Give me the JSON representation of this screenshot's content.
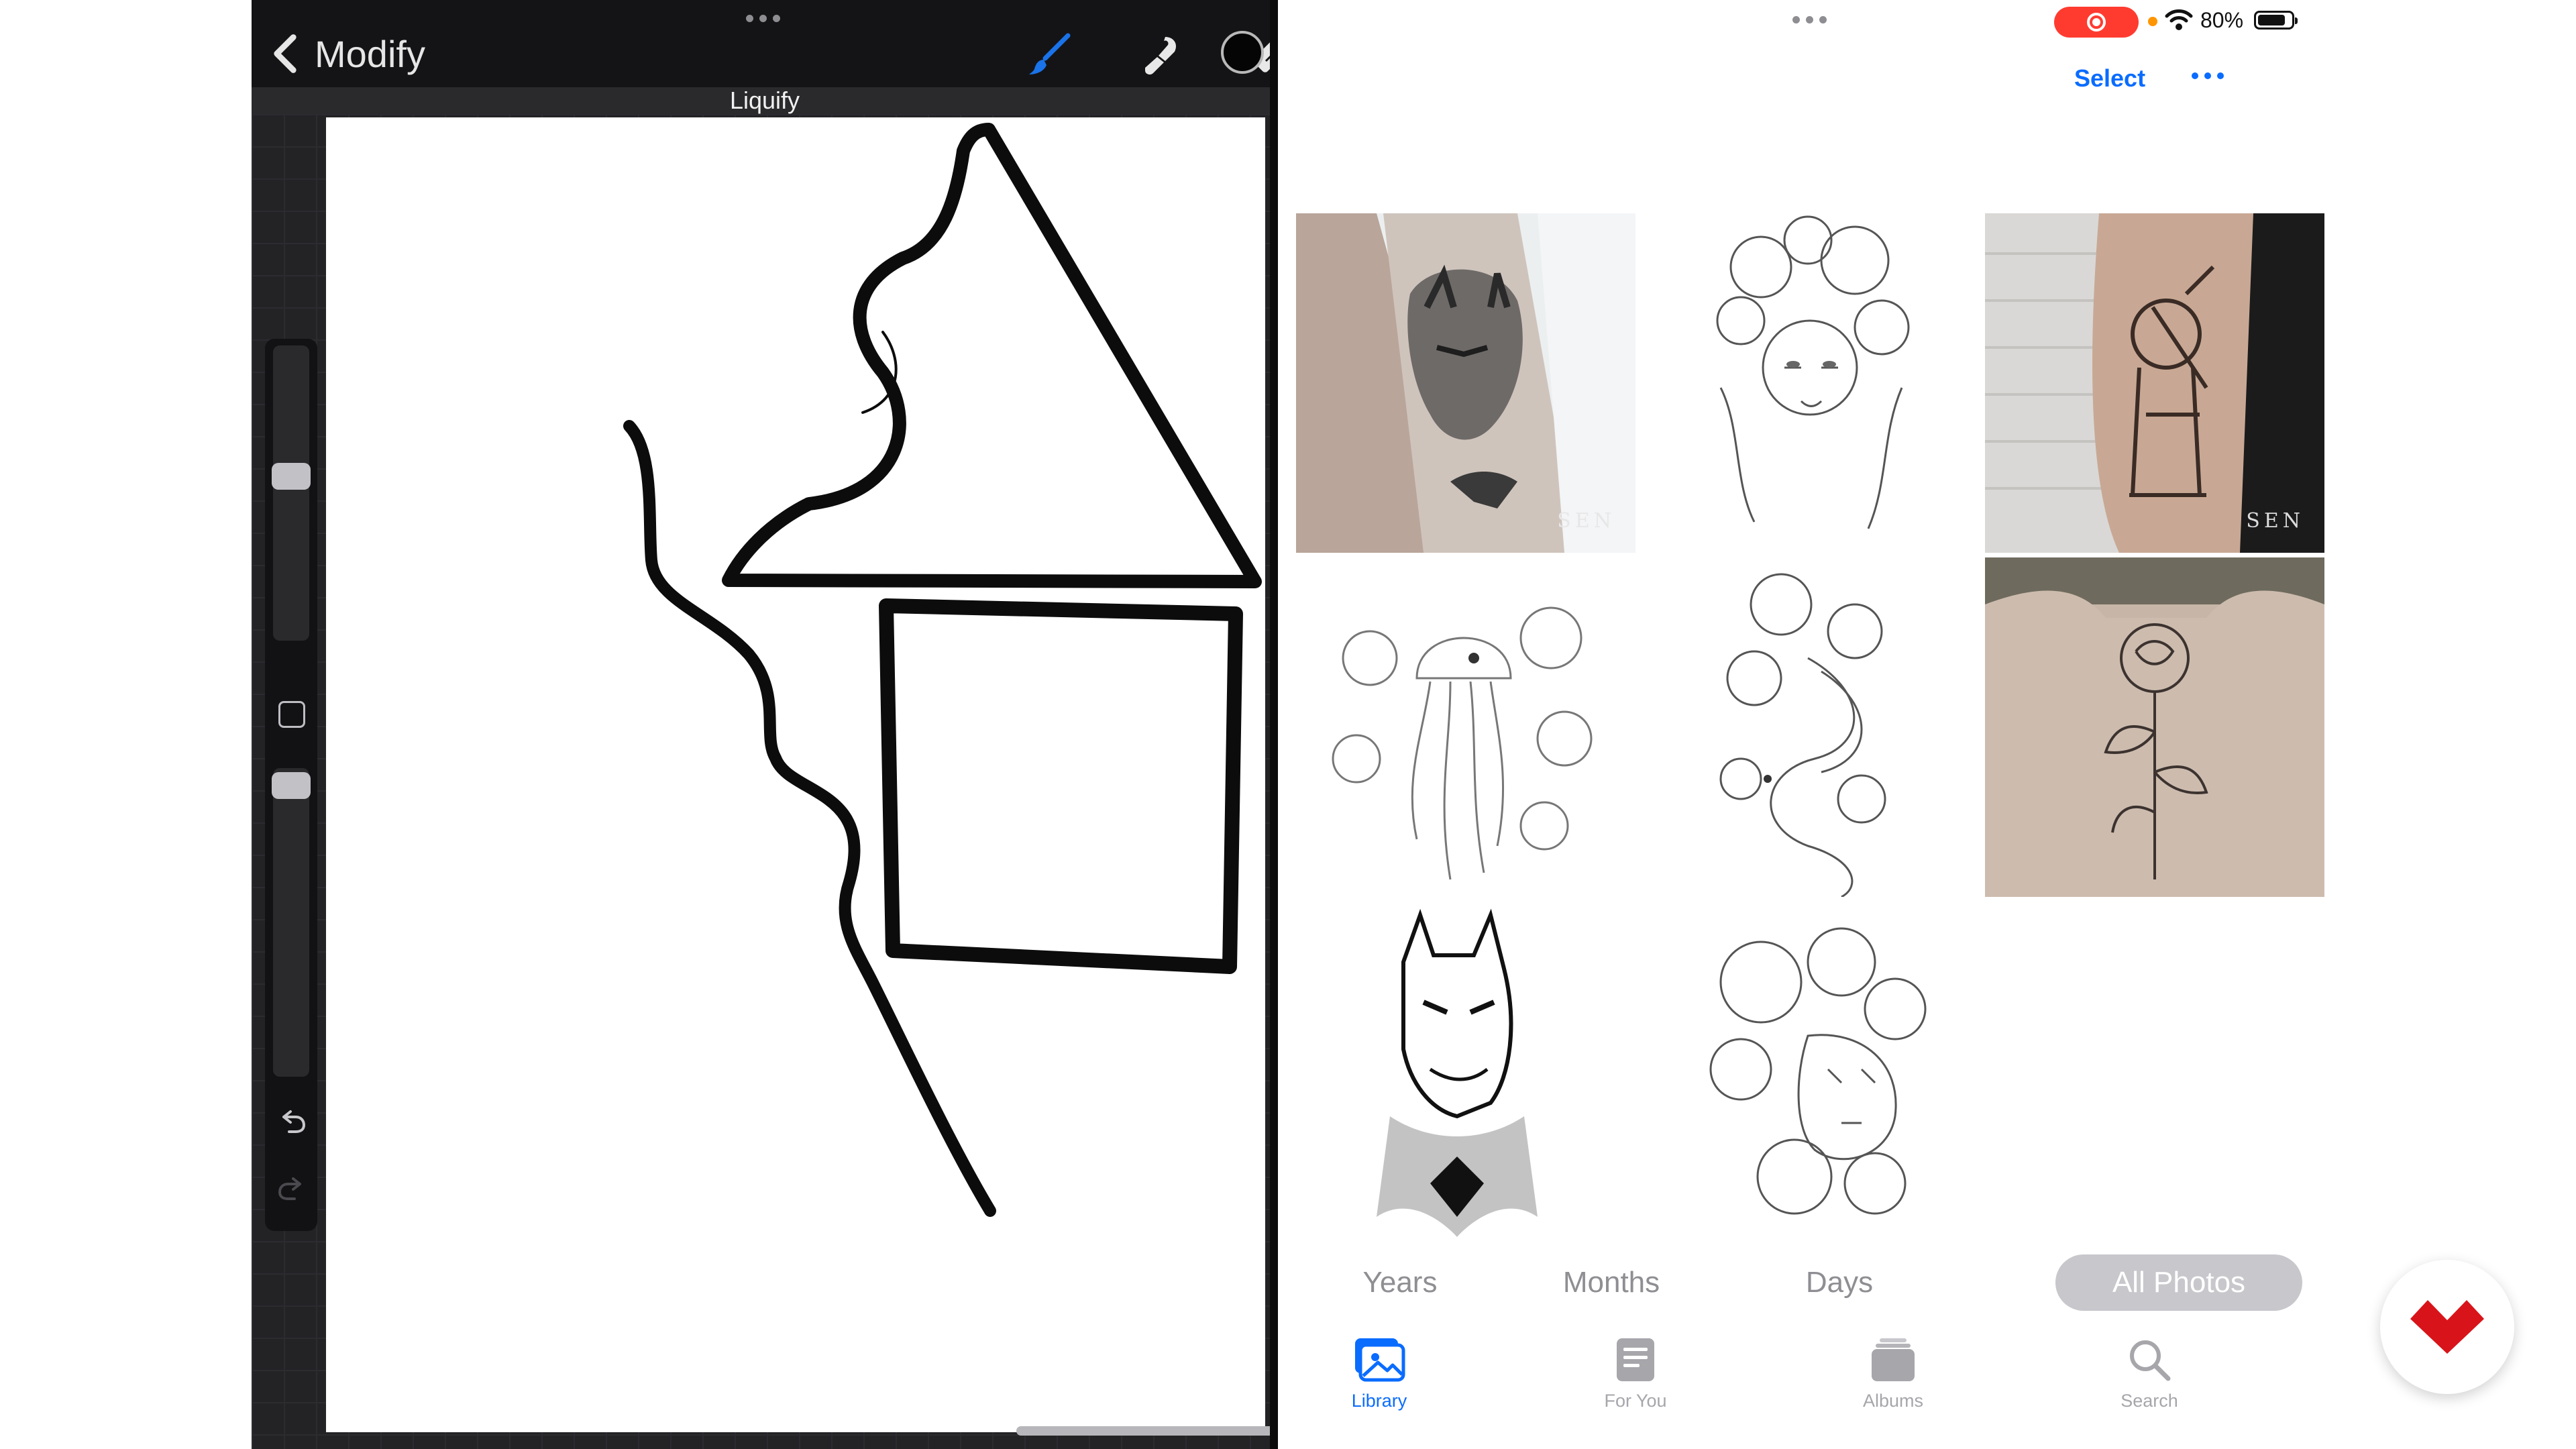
{
  "procreate": {
    "back_label": "Modify",
    "mode_label": "Liquify",
    "tools": [
      "brush-icon",
      "smudge-icon",
      "eraser-icon",
      "layers-icon"
    ],
    "active_tool": "brush",
    "current_color": "#050505",
    "accent_color": "#1a73e8"
  },
  "photos": {
    "status": {
      "battery_percent": "80%",
      "battery_level": 0.8,
      "recording": true
    },
    "select_label": "Select",
    "segments": [
      "Years",
      "Months",
      "Days",
      "All Photos"
    ],
    "active_segment": "All Photos",
    "watermark": "SEN",
    "thumbnails": [
      "batman-arm-tattoo-photo",
      "floral-woman-sketch",
      "samurai-arm-tattoo-photo",
      "jellyfish-floral-sketch",
      "dragon-floral-sketch",
      "rose-back-tattoo-photo",
      "batman-bust-sketch",
      "tiger-peony-sketch"
    ],
    "tabs": [
      {
        "label": "Library",
        "icon": "photo-library-icon",
        "active": true
      },
      {
        "label": "For You",
        "icon": "for-you-icon",
        "active": false
      },
      {
        "label": "Albums",
        "icon": "albums-icon",
        "active": false
      },
      {
        "label": "Search",
        "icon": "search-icon",
        "active": false
      }
    ],
    "accent_color": "#0a6cff"
  }
}
